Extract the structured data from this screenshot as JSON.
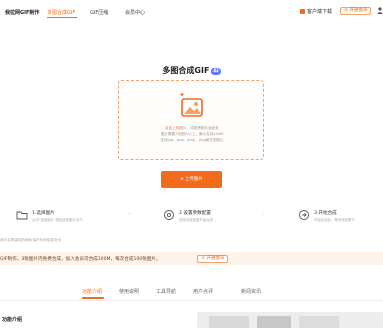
{
  "nav": {
    "brand": "我拉网GIF制作",
    "items": [
      "多图合成GIF",
      "GIF压缩",
      "会员中心"
    ],
    "download": "客户端下载",
    "vip": "开通会员"
  },
  "main": {
    "title": "多图合成GIF",
    "ai_badge": "AI",
    "dropzone": {
      "line1_highlight": "点击上传",
      "line1_rest": "图片，或拖拽图片到此处",
      "line2": "图片需要2张图片以上，最大支持100M",
      "line3": "支持jpg、png、bmp、png格式的图片"
    },
    "upload_button": "上传图片"
  },
  "steps": [
    {
      "title": "1.选择图片",
      "desc": "点击\"选择图片\"按钮选择图片文件"
    },
    {
      "title": "2.设置参数配置",
      "desc": "选择合适参数开始合成"
    },
    {
      "title": "3.开始合成",
      "desc": "开始合成后，等待完成即可"
    }
  ],
  "notice": "我们会尊重您的隐私保护权和信息安全",
  "promo": {
    "text": "GIF制作，3张图片内免费合成，加入会员可合成100M，每次合成100张图片。",
    "button": "开通会员"
  },
  "tabs": [
    "功能介绍",
    "使用说明",
    "工具导航",
    "用户点评",
    "新闻资讯"
  ],
  "section_title": "功能介绍",
  "colors": {
    "accent": "#f26b1d",
    "promo_bg": "#fdf3e8"
  }
}
